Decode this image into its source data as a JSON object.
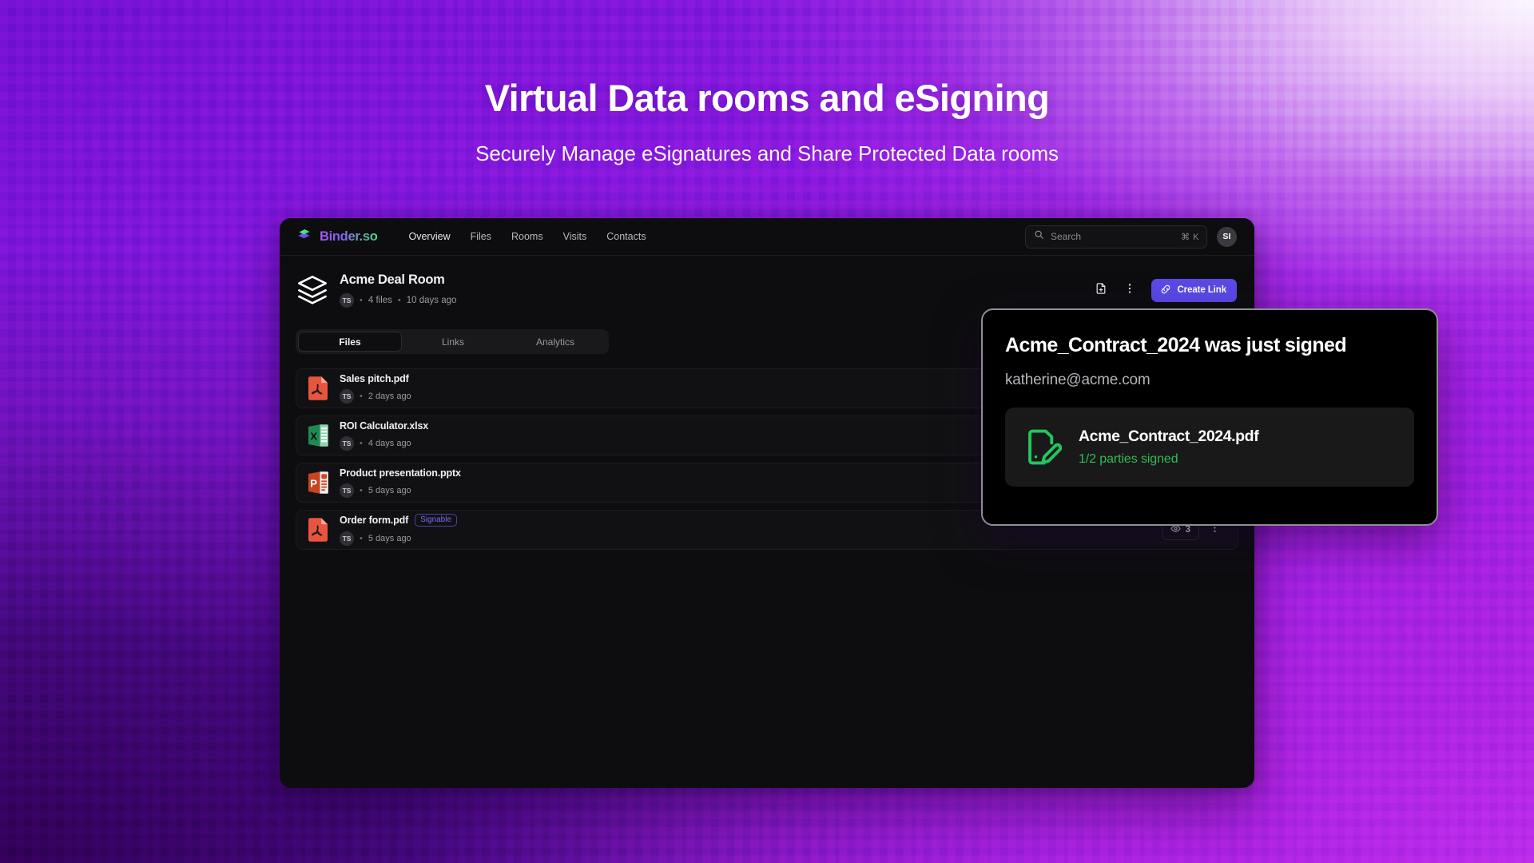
{
  "hero": {
    "title": "Virtual Data rooms and eSigning",
    "subtitle": "Securely Manage eSignatures and Share Protected Data rooms"
  },
  "app": {
    "topbar": {
      "brand": "Binder.so",
      "brand_icon": "layers-logo-icon",
      "nav": [
        {
          "label": "Overview",
          "active": true
        },
        {
          "label": "Files",
          "active": false
        },
        {
          "label": "Rooms",
          "active": false
        },
        {
          "label": "Visits",
          "active": false
        },
        {
          "label": "Contacts",
          "active": false
        }
      ],
      "search": {
        "placeholder": "Search",
        "icon": "search-icon",
        "shortcut": "⌘ K"
      },
      "avatar": "SI"
    },
    "room": {
      "icon": "layers-stack-icon",
      "title": "Acme Deal Room",
      "owner_initials": "TS",
      "file_count": "4 files",
      "updated": "10 days ago",
      "separator": "•",
      "actions": {
        "add_file_icon": "file-plus-icon",
        "more_icon": "more-vertical-icon",
        "create_link_label": "Create Link",
        "create_link_icon": "link-icon",
        "create_link_color": "#5b4ae8"
      }
    },
    "tabs": [
      {
        "label": "Files",
        "active": true
      },
      {
        "label": "Links",
        "active": false
      },
      {
        "label": "Analytics",
        "active": false
      }
    ],
    "files": [
      {
        "name": "Sales pitch.pdf",
        "type": "pdf",
        "owner_initials": "TS",
        "updated": "2 days ago",
        "badge": null,
        "views": null,
        "accent": "#e8553f"
      },
      {
        "name": "ROI Calculator.xlsx",
        "type": "xlsx",
        "owner_initials": "TS",
        "updated": "4 days ago",
        "badge": null,
        "views": null,
        "accent": "#21a366"
      },
      {
        "name": "Product presentation.pptx",
        "type": "pptx",
        "owner_initials": "TS",
        "updated": "5 days ago",
        "badge": null,
        "views": null,
        "accent": "#d24726"
      },
      {
        "name": "Order form.pdf",
        "type": "pdf",
        "owner_initials": "TS",
        "updated": "5 days ago",
        "badge": "Signable",
        "views": "3",
        "accent": "#e8553f"
      }
    ]
  },
  "notification": {
    "title": "Acme_Contract_2024 was just signed",
    "email": "katherine@acme.com",
    "file": {
      "icon": "file-signature-icon",
      "name": "Acme_Contract_2024.pdf",
      "status": "1/2 parties signed",
      "status_color": "#2fbd55"
    }
  }
}
